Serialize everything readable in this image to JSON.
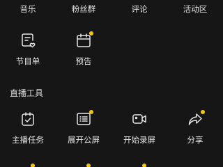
{
  "top_tabs": [
    "音乐",
    "粉丝群",
    "评论",
    "活动区"
  ],
  "row_items": [
    {
      "label": "节目单",
      "icon": "program-list-icon",
      "badge": false
    },
    {
      "label": "预告",
      "icon": "calendar-preview-icon",
      "badge": true
    }
  ],
  "section": {
    "title": "直播工具"
  },
  "tools": [
    {
      "label": "主播任务",
      "icon": "task-calendar-icon",
      "badge": false
    },
    {
      "label": "展开公屏",
      "icon": "public-screen-icon",
      "badge": true
    },
    {
      "label": "开始录屏",
      "icon": "video-record-icon",
      "badge": false
    },
    {
      "label": "分享",
      "icon": "share-arrow-icon",
      "badge": true
    }
  ],
  "colors": {
    "background": "#161616",
    "text": "#e6e6e6",
    "badge": "#f5c518"
  }
}
